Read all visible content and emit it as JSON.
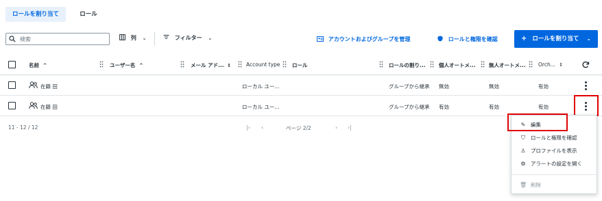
{
  "tabs": [
    {
      "label": "ロールを割り当て",
      "active": true
    },
    {
      "label": "ロール",
      "active": false
    }
  ],
  "toolbar": {
    "search_placeholder": "検索",
    "columns_label": "列",
    "filter_label": "フィルター",
    "manage_link": "アカウントおよびグループを管理",
    "check_link": "ロールと権限を確認",
    "assign_button": "ロールを割り当て"
  },
  "table": {
    "headers": {
      "name": "名前",
      "username": "ユーザー名",
      "email": "メール アド...",
      "account_type": "Account type",
      "role": "ロール",
      "role_assign": "ロールの割り...",
      "personal_auto": "個人オートメ...",
      "unattended": "無人オートメ...",
      "orch": "Orch..."
    },
    "rows": [
      {
        "name": "在籍 田",
        "account_type": "ローカル ユー...",
        "role_assign": "グループから継承",
        "personal_auto": "無効",
        "unattended": "無効",
        "orch": "有効"
      },
      {
        "name": "在籍 田",
        "account_type": "ローカル ユー...",
        "role_assign": "グループから継承",
        "personal_auto": "有効",
        "unattended": "有効",
        "orch": "有効"
      }
    ]
  },
  "footer": {
    "range": "11 - 12 / 12",
    "page": "ページ 2/2"
  },
  "menu": {
    "edit": "編集",
    "check_roles": "ロールと権限を確認",
    "show_profile": "プロファイルを表示",
    "alert_settings": "アラートの設定を開く",
    "delete": "削除"
  },
  "colors": {
    "accent": "#0067df",
    "highlight": "#e00000"
  }
}
